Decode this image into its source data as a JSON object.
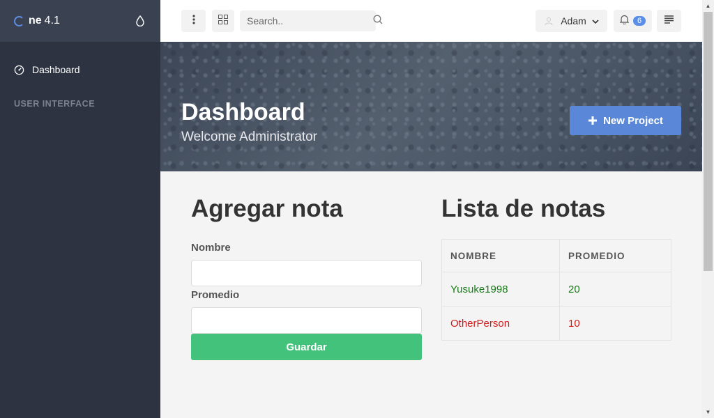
{
  "sidebar": {
    "brand_name": "ne",
    "brand_version": "4.1",
    "nav": [
      {
        "label": "Dashboard",
        "icon": "speedometer-icon"
      }
    ],
    "section_heading": "USER INTERFACE"
  },
  "topbar": {
    "search_placeholder": "Search..",
    "user_name": "Adam",
    "notification_count": "6"
  },
  "hero": {
    "title": "Dashboard",
    "subtitle": "Welcome Administrator",
    "new_project_label": "New Project"
  },
  "form": {
    "title": "Agregar nota",
    "name_label": "Nombre",
    "name_value": "",
    "average_label": "Promedio",
    "average_value": "",
    "save_label": "Guardar"
  },
  "list": {
    "title": "Lista de notas",
    "columns": [
      "NOMBRE",
      "PROMEDIO"
    ],
    "rows": [
      {
        "name": "Yusuke1998",
        "average": "20",
        "color": "#1a7a1a"
      },
      {
        "name": "OtherPerson",
        "average": "10",
        "color": "#d11a1a"
      }
    ]
  },
  "colors": {
    "sidebar_bg": "#2d3341",
    "accent": "#5b87d9",
    "save_button": "#42c27b"
  }
}
